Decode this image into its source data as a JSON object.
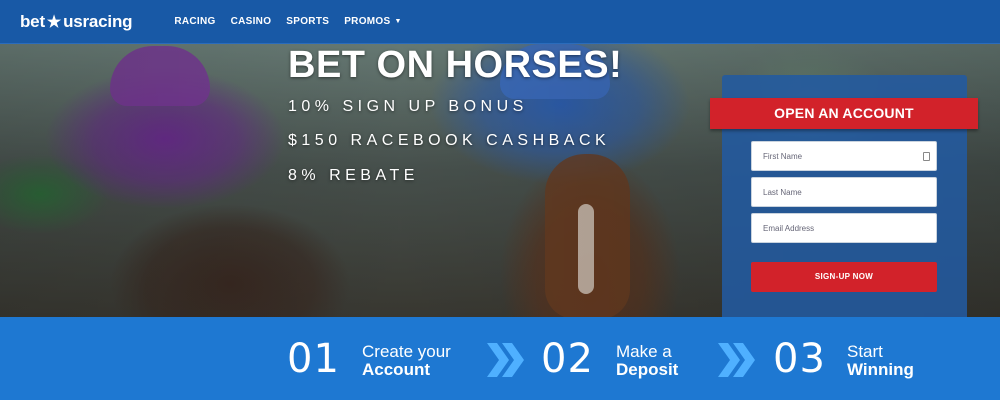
{
  "brand": {
    "part1": "bet",
    "star": "★",
    "part2": "usracing"
  },
  "nav": {
    "items": [
      {
        "label": "RACING"
      },
      {
        "label": "CASINO"
      },
      {
        "label": "SPORTS"
      },
      {
        "label": "PROMOS",
        "caret": "▼"
      }
    ]
  },
  "hero": {
    "headline": "BET ON HORSES!",
    "promos": [
      "10% SIGN UP BONUS",
      "$150 RACEBOOK CASHBACK",
      "8% REBATE"
    ]
  },
  "form": {
    "title": "OPEN AN ACCOUNT",
    "first_name_placeholder": "First Name",
    "last_name_placeholder": "Last Name",
    "email_placeholder": "Email Address",
    "submit_label": "SIGN-UP NOW"
  },
  "steps": [
    {
      "number": "01",
      "line1": "Create your",
      "line2": "Account"
    },
    {
      "number": "02",
      "line1": "Make a",
      "line2": "Deposit"
    },
    {
      "number": "03",
      "line1": "Start",
      "line2": "Winning"
    }
  ],
  "colors": {
    "nav_bg": "#1859a6",
    "accent_red": "#d2222a",
    "steps_bg": "#1e78d2",
    "chevron": "#4fb0ff"
  },
  "icons": [
    "star-icon",
    "caret-down-icon",
    "contact-card-icon",
    "double-chevron-right-icon"
  ]
}
